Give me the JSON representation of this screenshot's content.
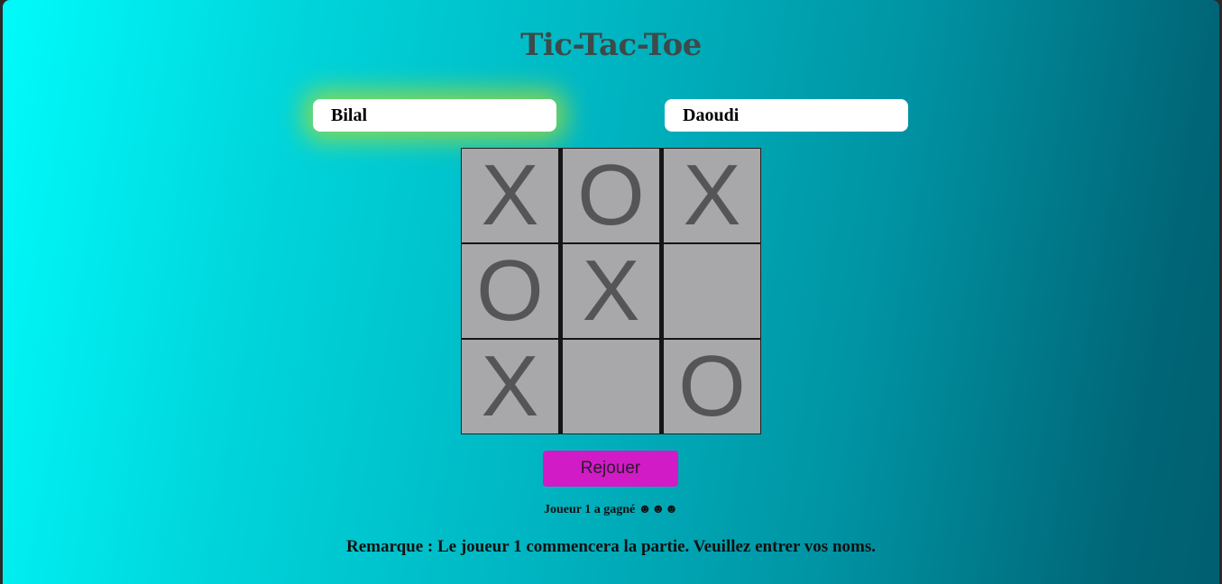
{
  "title": "Tic-Tac-Toe",
  "players": {
    "player1_value": "Bilal",
    "player2_value": "Daoudi"
  },
  "board": {
    "cells": [
      "X",
      "O",
      "X",
      "O",
      "X",
      "",
      "X",
      "",
      "O"
    ]
  },
  "replay_label": "Rejouer",
  "result_text": "Joueur 1 a gagné ☻☻☻",
  "note_text": "Remarque : Le joueur 1 commencera la partie. Veuillez entrer vos noms.",
  "colors": {
    "highlight_glow": "#b4dc28",
    "replay_button": "#d01bc6",
    "cell_background": "#a8a8aa",
    "mark_color": "#555557"
  }
}
